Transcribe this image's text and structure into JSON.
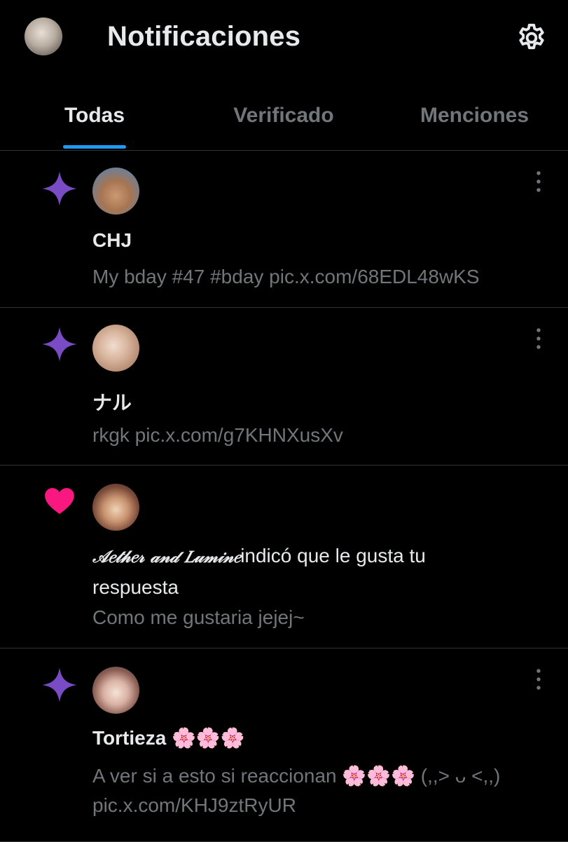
{
  "header": {
    "title": "Notificaciones",
    "avatar_icon": "profile-avatar",
    "settings_icon": "gear-icon"
  },
  "tabs": [
    {
      "label": "Todas",
      "active": true
    },
    {
      "label": "Verificado",
      "active": false
    },
    {
      "label": "Menciones",
      "active": false
    }
  ],
  "colors": {
    "background": "#000000",
    "accent": "#1d9bf0",
    "sparkle": "#794bc4",
    "heart": "#f91880",
    "muted_text": "#71767b",
    "primary_text": "#e7e9ea",
    "divider": "#2f3336"
  },
  "notifications": [
    {
      "type": "sparkle",
      "icon": "sparkle-icon",
      "name": "CHJ",
      "text": "My bday #47 #bday pic.x.com/68EDL48wKS"
    },
    {
      "type": "sparkle",
      "icon": "sparkle-icon",
      "name": "ナル",
      "text": "rkgk pic.x.com/g7KHNXusXv"
    },
    {
      "type": "like",
      "icon": "heart-icon",
      "name": "𝒜𝑒𝓉𝒽𝑒𝓇 𝒶𝓃𝒹 𝐿𝓊𝓂𝒾𝓃𝑒",
      "action": "indicó que le gusta tu respuesta",
      "text": "Como me gustaria jejej~"
    },
    {
      "type": "sparkle",
      "icon": "sparkle-icon",
      "name": "Tortieza 🌸🌸🌸",
      "text_line1": "A ver si a esto si reaccionan 🌸🌸🌸 (,,> ᴗ <,,)",
      "text_line2": "pic.x.com/KHJ9ztRyUR"
    }
  ]
}
